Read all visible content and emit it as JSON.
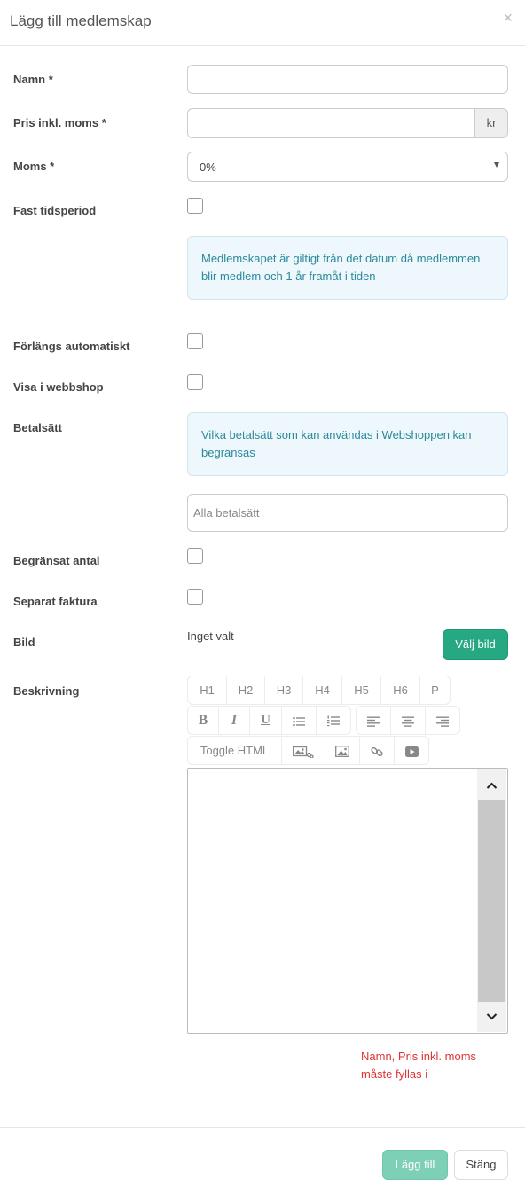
{
  "modal": {
    "title": "Lägg till medlemskap",
    "close_glyph": "×"
  },
  "form": {
    "name_label": "Namn *",
    "price_label": "Pris inkl. moms *",
    "price_addon": "kr",
    "vat_label": "Moms *",
    "vat_value": "0%",
    "fixed_period_label": "Fast tidsperiod",
    "fixed_period_info": "Medlemskapet är giltigt från det datum då medlemmen blir medlem och 1 år framåt i tiden",
    "auto_renew_label": "Förlängs automatiskt",
    "show_webshop_label": "Visa i webbshop",
    "payment_label": "Betalsätt",
    "payment_info": "Vilka betalsätt som kan användas i Webshoppen kan begränsas",
    "payment_placeholder": "Alla betalsätt",
    "limited_label": "Begränsat antal",
    "separate_invoice_label": "Separat faktura",
    "image_label": "Bild",
    "image_none": "Inget valt",
    "choose_image_button": "Välj bild",
    "description_label": "Beskrivning"
  },
  "toolbar": {
    "headings": [
      "H1",
      "H2",
      "H3",
      "H4",
      "H5",
      "H6",
      "P"
    ],
    "bold": "B",
    "italic": "I",
    "underline": "U",
    "toggle_html": "Toggle HTML",
    "icons": [
      "bold-icon",
      "italic-icon",
      "underline-icon",
      "bullet-list-icon",
      "numbered-list-icon",
      "align-left-icon",
      "align-center-icon",
      "align-right-icon",
      "image-link-icon",
      "image-icon",
      "link-icon",
      "video-icon"
    ]
  },
  "validation_error": "Namn, Pris inkl. moms måste fyllas i",
  "footer": {
    "add_button": "Lägg till",
    "close_button": "Stäng"
  },
  "colors": {
    "accent_green": "#26a883",
    "accent_green_disabled": "#7dcfb6",
    "info_bg": "#eef7fb",
    "info_text": "#2b8a9a",
    "error": "#dd3333"
  }
}
